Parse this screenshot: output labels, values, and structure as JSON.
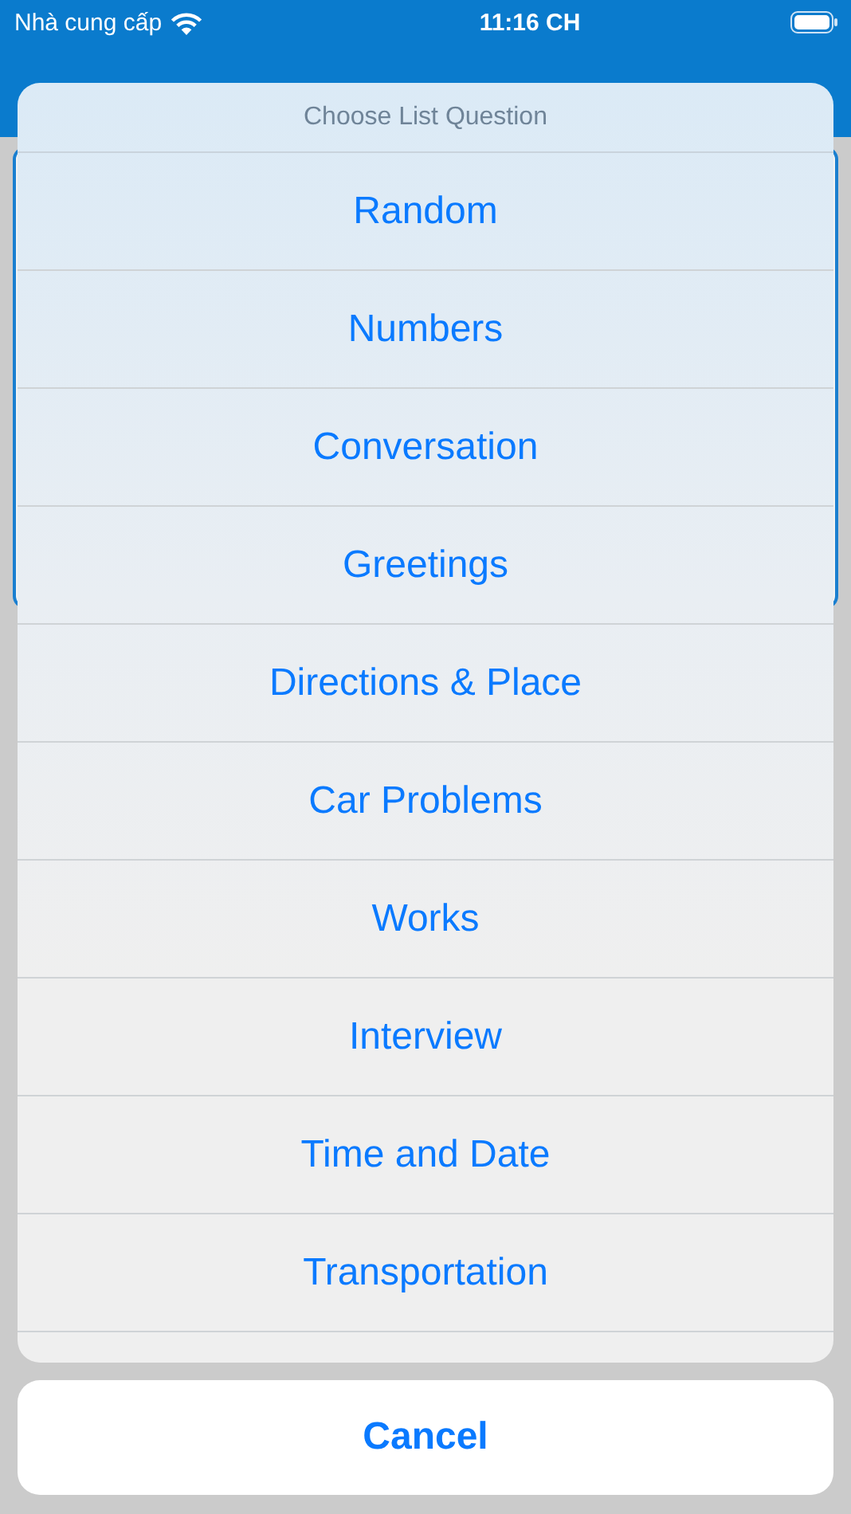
{
  "status_bar": {
    "carrier": "Nhà cung cấp",
    "time": "11:16 CH"
  },
  "action_sheet": {
    "title": "Choose List Question",
    "options": [
      {
        "label": "Random"
      },
      {
        "label": "Numbers"
      },
      {
        "label": "Conversation"
      },
      {
        "label": "Greetings"
      },
      {
        "label": "Directions & Place"
      },
      {
        "label": "Car Problems"
      },
      {
        "label": "Works"
      },
      {
        "label": "Interview"
      },
      {
        "label": "Time and Date"
      },
      {
        "label": "Transportation"
      }
    ],
    "cancel": "Cancel"
  }
}
